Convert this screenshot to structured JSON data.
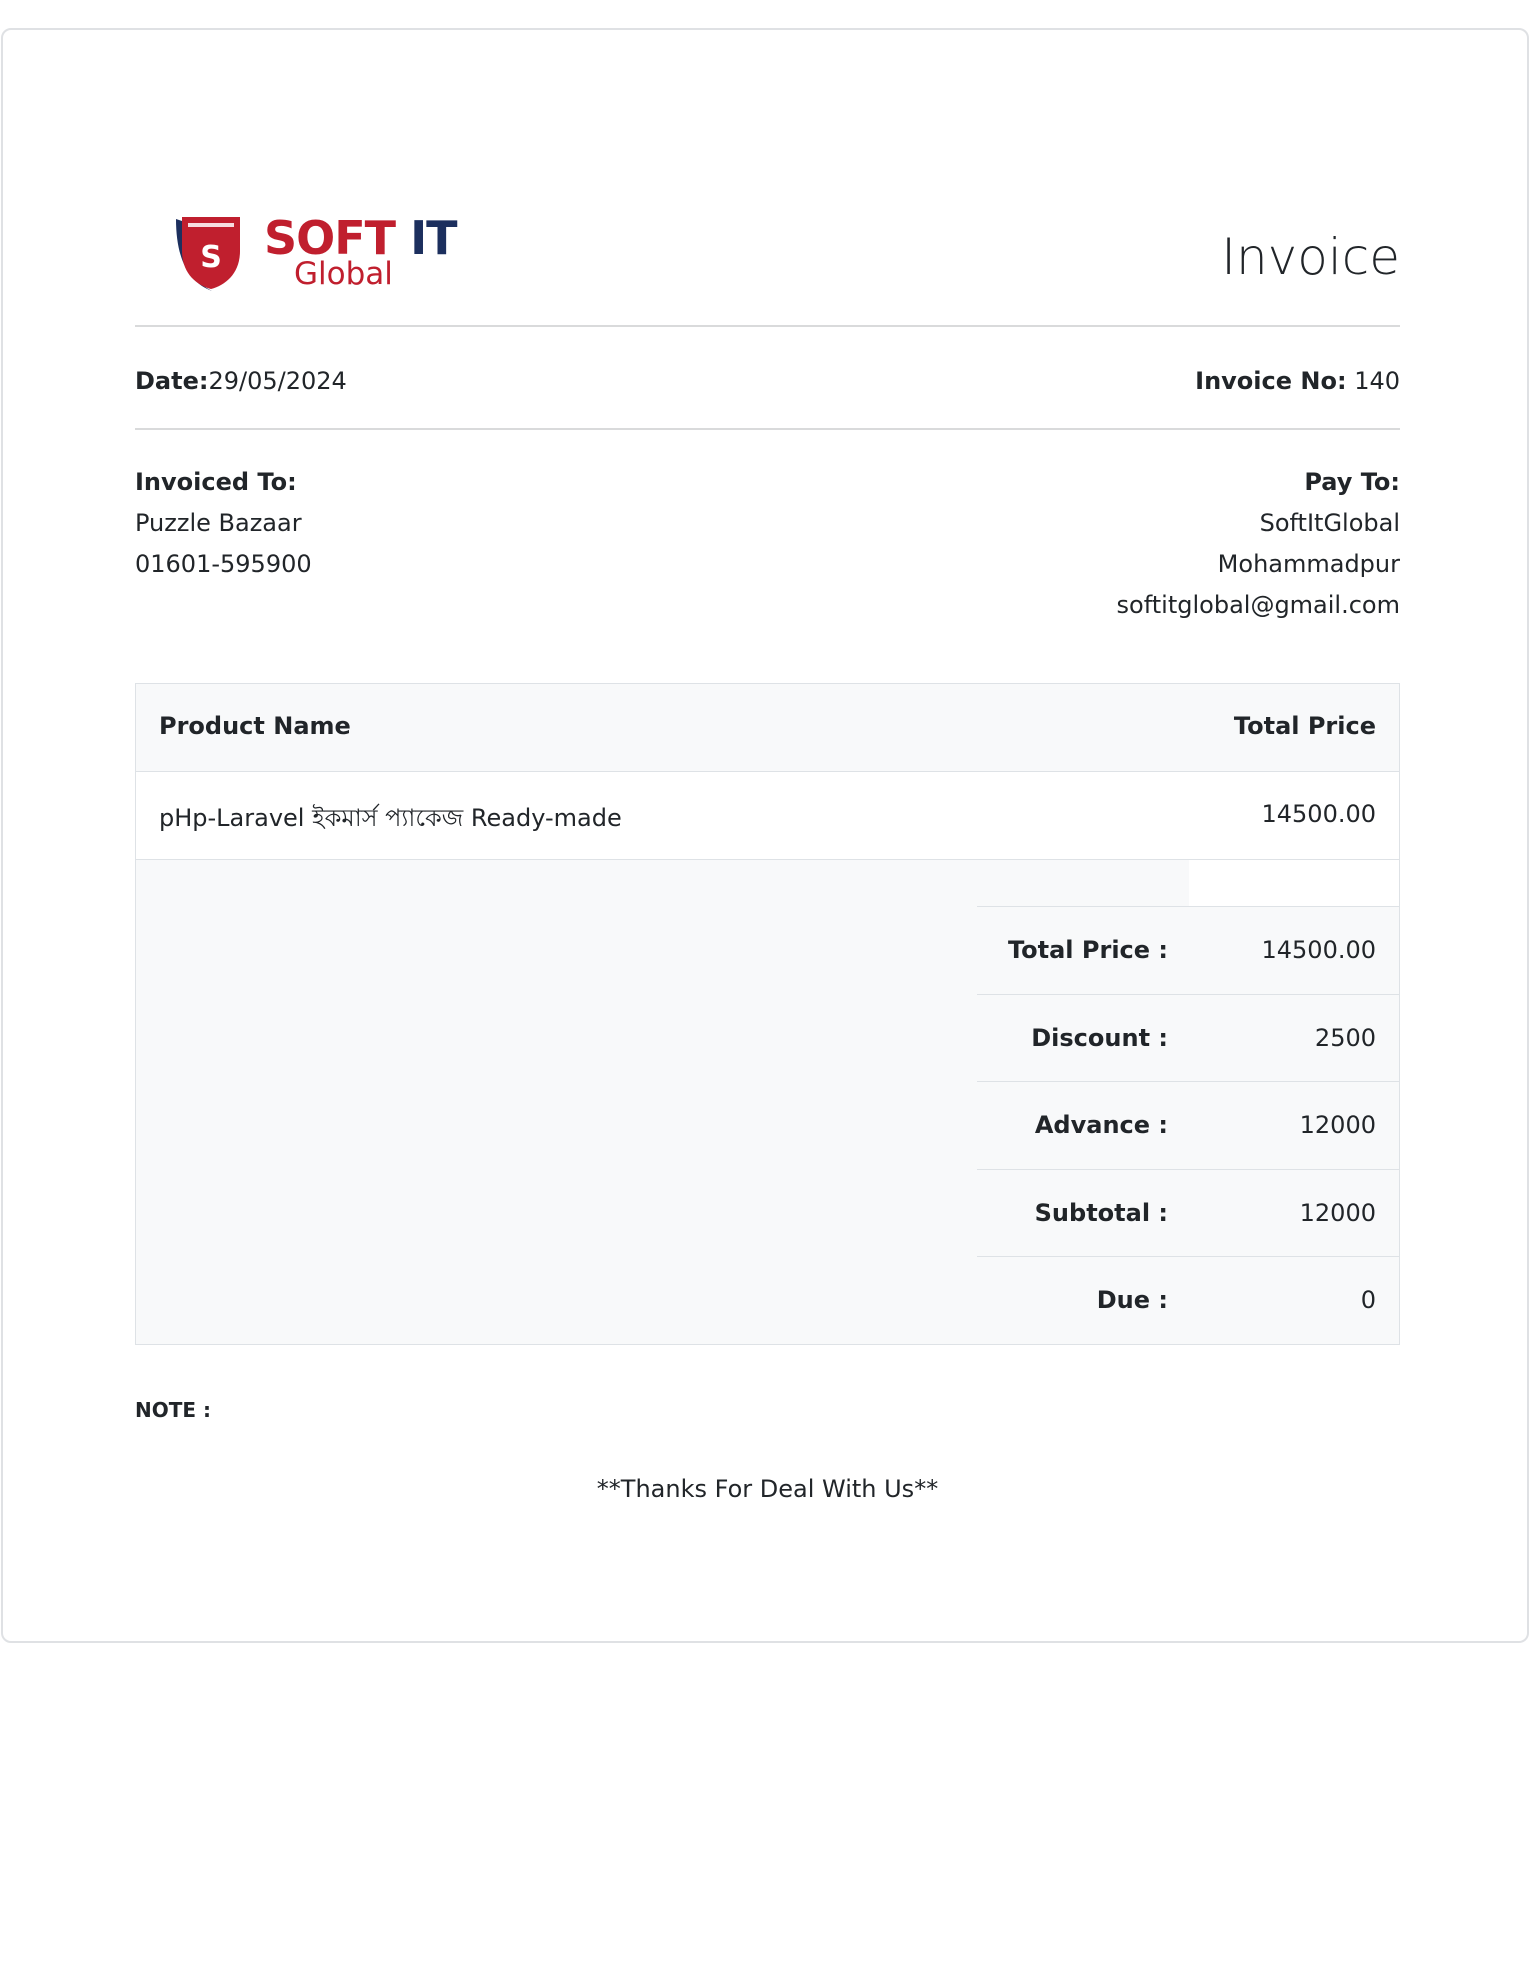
{
  "logo": {
    "brand_soft": "SOFT",
    "brand_it": "IT",
    "brand_sub": "Global"
  },
  "invoice": {
    "title": "Invoice",
    "date_label": "Date:",
    "date_value": "29/05/2024",
    "number_label": "Invoice No:",
    "number_value": "140"
  },
  "invoiced_to": {
    "label": "Invoiced To:",
    "name": "Puzzle Bazaar",
    "phone": "01601-595900"
  },
  "pay_to": {
    "label": "Pay To:",
    "name": "SoftItGlobal",
    "address": "Mohammadpur",
    "email": "softitglobal@gmail.com"
  },
  "table": {
    "headers": [
      "Product Name",
      "Total Price"
    ],
    "rows": [
      {
        "product": "pHp-Laravel ইকমার্স প্যাকেজ Ready-made",
        "price": "14500.00"
      }
    ]
  },
  "summary": [
    {
      "label": "Total Price :",
      "value": "14500.00"
    },
    {
      "label": "Discount :",
      "value": "2500"
    },
    {
      "label": "Advance :",
      "value": "12000"
    },
    {
      "label": "Subtotal :",
      "value": "12000"
    },
    {
      "label": "Due :",
      "value": "0"
    }
  ],
  "note_label": "NOTE :",
  "thanks": "**Thanks For Deal With Us**",
  "colors": {
    "brand_red": "#c01f2e",
    "brand_navy": "#1c2f5e"
  }
}
